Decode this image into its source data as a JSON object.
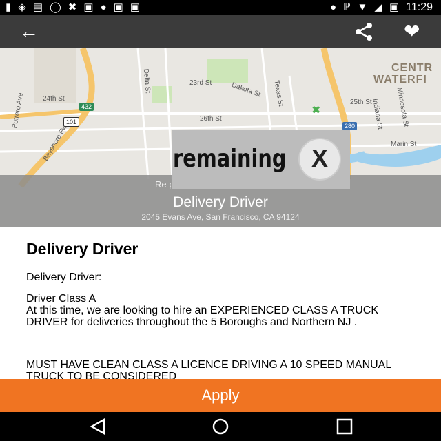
{
  "status_bar": {
    "time": "11:29",
    "icons_left": [
      "notification-icon",
      "location-icon",
      "message-icon",
      "alarm-off-icon",
      "tool-icon",
      "lock-icon",
      "game-icon",
      "camera-icon",
      "briefcase-icon"
    ],
    "icons_right": [
      "location-pin-icon",
      "bluetooth-icon",
      "wifi-icon",
      "signal-off-icon",
      "battery-charging-icon"
    ]
  },
  "app_bar": {
    "back_icon": "back-arrow-icon",
    "share_icon": "share-icon",
    "favorite_icon": "heart-icon"
  },
  "map": {
    "labels": [
      "24th St",
      "23rd St",
      "26th St",
      "25th St",
      "Dakota St",
      "Texas St",
      "Indiana St",
      "Minnesota St",
      "Delta St",
      "Marin St",
      "Potrero Ave",
      "Bayshore Fwy"
    ],
    "area_label_line1": "CENTR",
    "area_label_line2": "WATERFI",
    "shields": [
      "432",
      "101",
      "280"
    ]
  },
  "overlay": {
    "cutoff_text": "Re                               p",
    "job_title": "Delivery Driver",
    "address": "2045 Evans Ave, San Francisco, CA 94124"
  },
  "ad_badge": {
    "text": "remaining",
    "close_glyph": "X"
  },
  "content": {
    "heading": "Delivery Driver",
    "line1": "Delivery Driver:",
    "para2": "Driver Class A\nAt this time, we are looking to hire an EXPERIENCED CLASS A TRUCK DRIVER for deliveries throughout the 5 Boroughs and Northern NJ .",
    "para3": "MUST HAVE CLEAN CLASS A LICENCE DRIVING A 10 SPEED MANUAL TRUCK TO BE CONSIDERED"
  },
  "apply_button": {
    "label": "Apply"
  },
  "nav_bar": {
    "back_icon": "nav-back-icon",
    "home_icon": "nav-home-icon",
    "recents_icon": "nav-recents-icon"
  },
  "colors": {
    "accent": "#f07422",
    "app_bar": "#3b3b3b"
  }
}
